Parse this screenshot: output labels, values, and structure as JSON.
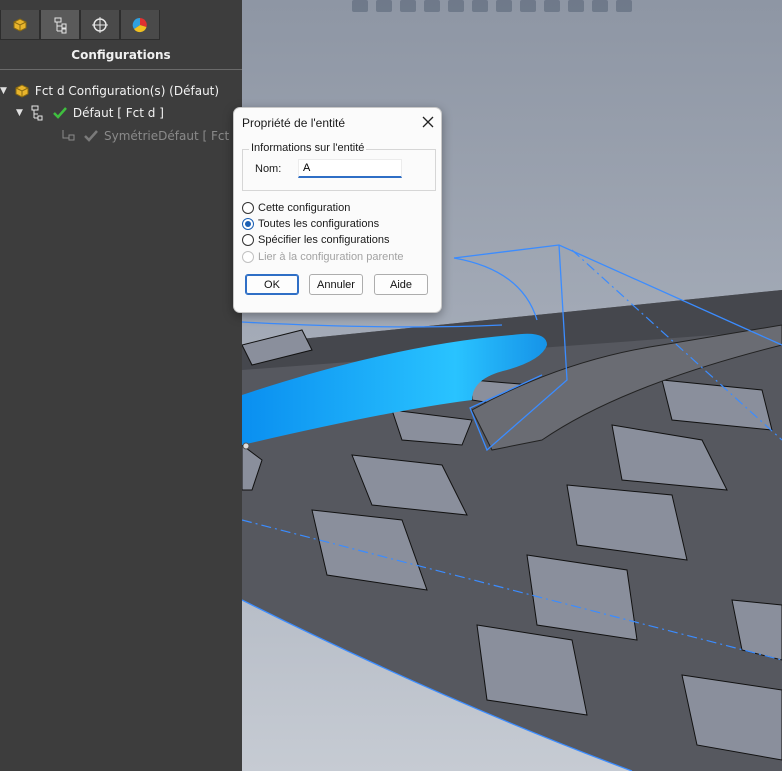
{
  "panel": {
    "tabs": [
      {
        "icon": "feature-manager-icon"
      },
      {
        "icon": "configuration-manager-icon"
      },
      {
        "icon": "dimxpert-icon"
      },
      {
        "icon": "display-manager-icon"
      }
    ],
    "title": "Configurations",
    "tree": [
      {
        "label": "Fct d Configuration(s)  (Défaut)"
      },
      {
        "label": "Défaut [ Fct d ]"
      },
      {
        "label": "SymétrieDéfaut [ Fct d ]"
      }
    ]
  },
  "dialog": {
    "title": "Propriété de l'entité",
    "group_title": "Informations sur l'entité",
    "name_label": "Nom:",
    "name_value": "A",
    "options": [
      {
        "label": "Cette configuration",
        "checked": false,
        "enabled": true
      },
      {
        "label": "Toutes les configurations",
        "checked": true,
        "enabled": true
      },
      {
        "label": "Spécifier les configurations",
        "checked": false,
        "enabled": true
      },
      {
        "label": "Lier à la configuration parente",
        "checked": false,
        "enabled": false
      }
    ],
    "ok_label": "OK",
    "cancel_label": "Annuler",
    "help_label": "Aide"
  },
  "colors": {
    "accent": "#2f6fc6",
    "highlight_surface": "#1ea6f5",
    "panel_bg": "#3d3d3d",
    "check_green": "#3fbf3f"
  }
}
